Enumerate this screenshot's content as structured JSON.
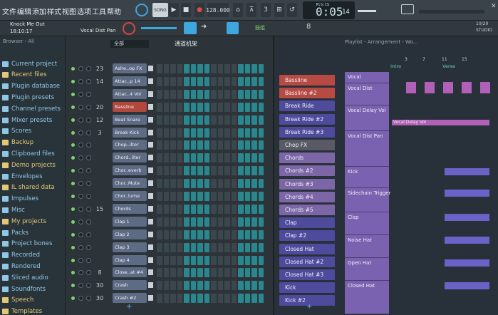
{
  "menu": [
    "文件",
    "编辑",
    "添加",
    "样式",
    "视图",
    "选项",
    "工具",
    "帮助"
  ],
  "song_label": "SONG",
  "tempo": "128.000",
  "time": {
    "main": "0:05",
    "sub": "14",
    "label": "M:S:CS"
  },
  "project": {
    "title": "Knock Me Out",
    "time": "18:10:17",
    "hint": "Vocal Dist Pan"
  },
  "pattern_label": "鼓组",
  "pattern_number": "8",
  "cpu": {
    "top": "10/20",
    "bottom": "STUDIO"
  },
  "browser": {
    "header": "Browser - All",
    "items": [
      {
        "label": "Current project",
        "color": "#8fc8e6"
      },
      {
        "label": "Recent files",
        "color": "#e3c774"
      },
      {
        "label": "Plugin database",
        "color": "#8fc8e6"
      },
      {
        "label": "Plugin presets",
        "color": "#8fc8e6"
      },
      {
        "label": "Channel presets",
        "color": "#8fc8e6"
      },
      {
        "label": "Mixer presets",
        "color": "#8fc8e6"
      },
      {
        "label": "Scores",
        "color": "#8fc8e6"
      },
      {
        "label": "Backup",
        "color": "#e3c774"
      },
      {
        "label": "Clipboard files",
        "color": "#8fc8e6"
      },
      {
        "label": "Demo projects",
        "color": "#e3c774"
      },
      {
        "label": "Envelopes",
        "color": "#8fc8e6"
      },
      {
        "label": "IL shared data",
        "color": "#e3c774"
      },
      {
        "label": "Impulses",
        "color": "#8fc8e6"
      },
      {
        "label": "Misc",
        "color": "#8fc8e6"
      },
      {
        "label": "My projects",
        "color": "#e3c774"
      },
      {
        "label": "Packs",
        "color": "#8fc8e6"
      },
      {
        "label": "Project bones",
        "color": "#8fc8e6"
      },
      {
        "label": "Recorded",
        "color": "#8fc8e6"
      },
      {
        "label": "Rendered",
        "color": "#8fc8e6"
      },
      {
        "label": "Sliced audio",
        "color": "#8fc8e6"
      },
      {
        "label": "Soundfonts",
        "color": "#8fc8e6"
      },
      {
        "label": "Speech",
        "color": "#e3c774"
      },
      {
        "label": "Templates",
        "color": "#e3c774"
      }
    ]
  },
  "rack": {
    "filter": "全部",
    "title": "通道机架",
    "channels": [
      {
        "num": "23",
        "name": "Ashe..op FX",
        "color": "#5d6b85"
      },
      {
        "num": "14",
        "name": "Attac..p 14",
        "color": "#5d6b85"
      },
      {
        "num": "",
        "name": "Attac..4 Vol",
        "color": "#5d6b85"
      },
      {
        "num": "20",
        "name": "Bassline",
        "color": "#b2473e"
      },
      {
        "num": "12",
        "name": "Beat Snare",
        "color": "#5d6b85"
      },
      {
        "num": "3",
        "name": "Break Kick",
        "color": "#5d6b85"
      },
      {
        "num": "",
        "name": "Chop..ilter",
        "color": "#5d6b85"
      },
      {
        "num": "",
        "name": "Chord..ilter",
        "color": "#5d6b85"
      },
      {
        "num": "",
        "name": "Chor..everb",
        "color": "#5d6b85"
      },
      {
        "num": "",
        "name": "Chor..Mute",
        "color": "#5d6b85"
      },
      {
        "num": "",
        "name": "Chor..lume",
        "color": "#5d6b85"
      },
      {
        "num": "15",
        "name": "Chords",
        "color": "#5d6b85"
      },
      {
        "num": "",
        "name": "Clap 1",
        "color": "#5d6b85"
      },
      {
        "num": "",
        "name": "Clap 2",
        "color": "#5d6b85"
      },
      {
        "num": "",
        "name": "Clap 3",
        "color": "#5d6b85"
      },
      {
        "num": "",
        "name": "Clap 4",
        "color": "#5d6b85"
      },
      {
        "num": "8",
        "name": "Close..at #4",
        "color": "#5d6b85"
      },
      {
        "num": "30",
        "name": "Crash",
        "color": "#5d6b85"
      },
      {
        "num": "30",
        "name": "Crash #2",
        "color": "#5d6b85"
      }
    ]
  },
  "playlist": {
    "title": "Playlist - Arrangement - Wo...",
    "markers": [
      "Intro",
      "Verse"
    ],
    "bar_numbers": [
      "3",
      "7",
      "11",
      "15"
    ],
    "clips": [
      {
        "label": "Bassline",
        "color": "#b84a44"
      },
      {
        "label": "Bassline #2",
        "color": "#b84a44"
      },
      {
        "label": "Break Ride",
        "color": "#4e4a9c"
      },
      {
        "label": "Break Ride #2",
        "color": "#4e4a9c"
      },
      {
        "label": "Break Ride #3",
        "color": "#4e4a9c"
      },
      {
        "label": "Chop FX",
        "color": "#5a5a66"
      },
      {
        "label": "Chords",
        "color": "#7c66a6"
      },
      {
        "label": "Chords #2",
        "color": "#7c66a6"
      },
      {
        "label": "Chords #3",
        "color": "#7c66a6"
      },
      {
        "label": "Chords #4",
        "color": "#7c66a6"
      },
      {
        "label": "Chords #5",
        "color": "#7c66a6"
      },
      {
        "label": "Clap",
        "color": "#4e4a9c"
      },
      {
        "label": "Clap #2",
        "color": "#4e4a9c"
      },
      {
        "label": "Closed Hat",
        "color": "#4e4a9c"
      },
      {
        "label": "Closed Hat #2",
        "color": "#4e4a9c"
      },
      {
        "label": "Closed Hat #3",
        "color": "#4e4a9c"
      },
      {
        "label": "Kick",
        "color": "#4e4a9c"
      },
      {
        "label": "Kick #2",
        "color": "#4e4a9c"
      }
    ],
    "tracks": [
      "Vocal",
      "Vocal Dist",
      "Vocal Delay Vol",
      "Vocal Dist Pan",
      "Kick",
      "Sidechain Trigger",
      "Clap",
      "Noise Hat",
      "Open Hat",
      "Closed Hat"
    ],
    "lane_clip": "Vocal Delay Vol"
  },
  "add_label": "+"
}
